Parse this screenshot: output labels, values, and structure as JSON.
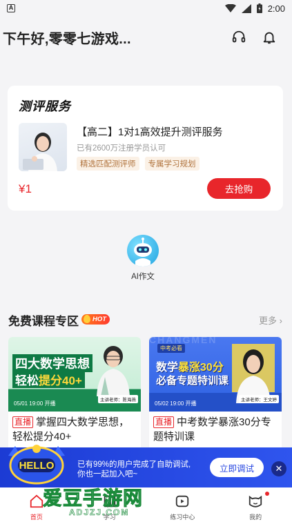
{
  "status_bar": {
    "time": "2:00",
    "left_badge": "A"
  },
  "header": {
    "greeting": "下午好,零零七游戏..."
  },
  "service_card": {
    "title": "测评服务",
    "course_title": "【高二】1对1高效提升测评服务",
    "course_sub": "已有2600万注册学员认可",
    "tags": [
      "精选匹配测评师",
      "专属学习规划"
    ],
    "price": "¥1",
    "buy_label": "去抢购"
  },
  "ai_entry": {
    "label": "AI作文"
  },
  "free_courses": {
    "title": "免费课程专区",
    "hot": "HOT",
    "more": "更多",
    "cards": [
      {
        "banner_line1": "四大数学思想",
        "banner_line2_a": "轻松",
        "banner_line2_b": "提分40+",
        "date": "05/01 19:00 开播",
        "teacher": "主讲老师：陈海燕",
        "live": "直播",
        "title": "掌握四大数学思想，轻松提分40+"
      },
      {
        "banner_tag": "中考必看",
        "banner_line1_a": "数学",
        "banner_line1_b": "暴涨30分",
        "banner_line2": "必备专题特训课",
        "watermark": "CHANGMEN",
        "date": "05/02 19:00 开播",
        "teacher": "主讲老师：王文婷",
        "live": "直播",
        "title": "中考数学暴涨30分专题特训课"
      }
    ]
  },
  "debug_banner": {
    "bot_text": "HELLO",
    "line1": "已有99%的用户完成了自助调试,",
    "line2": "你也一起加入吧~",
    "button": "立即调试",
    "close": "✕"
  },
  "bottom_nav": {
    "items": [
      {
        "label": "首页",
        "active": true
      },
      {
        "label": "学习",
        "active": false
      },
      {
        "label": "练习中心",
        "active": false
      },
      {
        "label": "我的",
        "active": false,
        "dot": true
      }
    ]
  },
  "watermark": {
    "main": "爱豆手游网",
    "sub": "ADJZJ.COM"
  },
  "colors": {
    "accent": "#e8262b",
    "debug_blue": "#2646e0"
  }
}
